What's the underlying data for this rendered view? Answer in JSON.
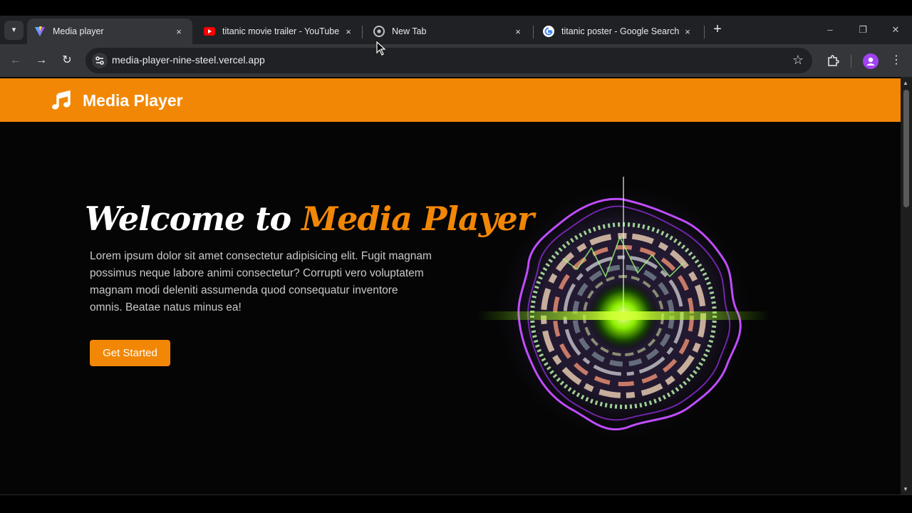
{
  "browser": {
    "tabs": [
      {
        "title": "Media player",
        "active": true
      },
      {
        "title": "titanic movie trailer - YouTube",
        "active": false
      },
      {
        "title": "New Tab",
        "active": false
      },
      {
        "title": "titanic poster - Google Search",
        "active": false
      }
    ],
    "close_glyph": "×",
    "new_tab_glyph": "+",
    "url": "media-player-nine-steel.vercel.app",
    "window_controls": {
      "minimize": "–",
      "restore": "❐",
      "close": "✕"
    }
  },
  "site": {
    "brand": "Media Player",
    "hero": {
      "title_white": "Welcome to",
      "title_orange": "Media Player",
      "description": "Lorem ipsum dolor sit amet consectetur adipisicing elit. Fugit magnam possimus neque labore animi consectetur? Corrupti vero voluptatem magnam modi deleniti assumenda quod consequatur inventore omnis. Beatae natus minus ea!",
      "cta": "Get Started"
    }
  },
  "colors": {
    "accent": "#f28705",
    "chrome_dark": "#202124",
    "chrome_mid": "#35363a",
    "page_bg": "#050505"
  },
  "icons": {
    "brand": "music-note-icon",
    "hero_visual": "audio-spectrum-visualizer"
  }
}
